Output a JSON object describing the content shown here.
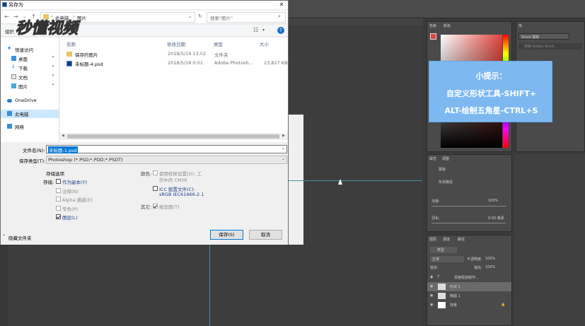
{
  "dialog": {
    "title": "另存为",
    "breadcrumb": [
      "此电脑",
      "图片"
    ],
    "search_placeholder": "搜索\"图片\"",
    "organize_label": "组织",
    "help_label": "?",
    "nav": {
      "quick_access": "快速访问",
      "items": [
        {
          "label": "桌面",
          "pin": "📌"
        },
        {
          "label": "下载",
          "pin": "📌"
        },
        {
          "label": "文档",
          "pin": "📌"
        },
        {
          "label": "图片",
          "pin": "📌"
        }
      ],
      "onedrive": "OneDrive",
      "this_pc": "此电脑",
      "network": "网络"
    },
    "columns": {
      "name": "名称",
      "date": "修改日期",
      "type": "类型",
      "size": "大小"
    },
    "files": [
      {
        "name": "保存的图片",
        "date": "2018/5/19 13:02",
        "type": "文件夹",
        "size": ""
      },
      {
        "name": "未标题-4.psd",
        "date": "2018/5/18 0:01",
        "type": "Adobe Photosh...",
        "size": "23,827 KB"
      }
    ],
    "filename_label": "文件名(N):",
    "filename_value": "未标题-1.psd",
    "filetype_label": "保存类型(T):",
    "filetype_value": "Photoshop (*.PSD;*.PDD;*.PSDT)",
    "save_options_label": "存储选项",
    "store_label": "存储:",
    "store_options": [
      {
        "label": "作为副本(Y)",
        "checked": false,
        "disabled": false,
        "blue": true
      },
      {
        "label": "注释(N)",
        "checked": false,
        "disabled": true
      },
      {
        "label": "Alpha 通道(E)",
        "checked": false,
        "disabled": true
      },
      {
        "label": "专色(P)",
        "checked": false,
        "disabled": true
      },
      {
        "label": "图层(L)",
        "checked": true,
        "disabled": false,
        "blue": true
      }
    ],
    "color_label": "颜色:",
    "proof_setup_label": "使用校样设置(O): 工",
    "proof_setup_label2": "作中的 CMYK",
    "icc_label": "ICC 配置文件(C):",
    "icc_label2": "sRGB IEC61966-2.1",
    "other_label": "其它:",
    "thumbnail_label": "缩览图(T)",
    "hide_folders": "隐藏文件夹",
    "save_button": "保存(S)",
    "cancel_button": "取消"
  },
  "watermark": "秒懂视频",
  "tip": {
    "line1": "小提示：",
    "line2": "自定义形状工具-SHIFT+",
    "line3": "ALT-绘制五角星-CTRL+S"
  },
  "ps_panels": {
    "color_tab": "颜色",
    "swatches_tab": "色板",
    "library_tab": "库",
    "stock_label": "Stock 模板",
    "search_adobe": "搜索 Adobe Stock",
    "props_tab": "属性",
    "adjust_tab": "调整",
    "mask_label": "蒙版",
    "shape_path": "形状路径",
    "density_label": "浓度:",
    "density_value": "100%",
    "feather_label": "羽化:",
    "feather_value": "0.00 像素",
    "layers_tab": "图层",
    "channels_tab": "通道",
    "paths_tab": "路径",
    "kind_label": "类型",
    "blend_mode": "正常",
    "opacity_label": "不透明度:",
    "opacity_value": "100%",
    "lock_label": "锁定:",
    "fill_label": "填充:",
    "fill_value": "100%",
    "layers": [
      "百度经验制作...",
      "形状 1",
      "椭圆 1",
      "背景"
    ]
  },
  "colors": {
    "accent": "#0078d7",
    "tip_bg": "#7eb8f0",
    "ps_red": "#e0443c"
  }
}
